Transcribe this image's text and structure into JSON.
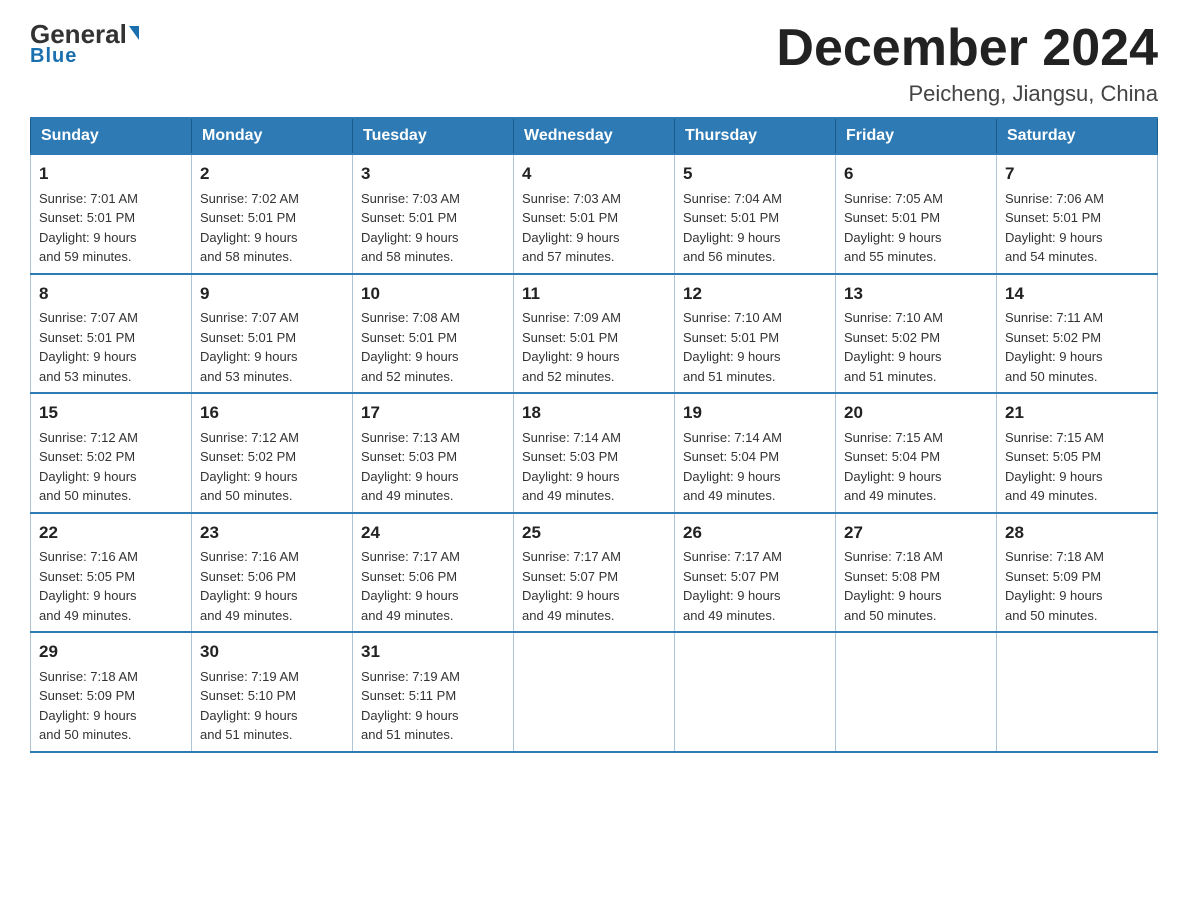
{
  "logo": {
    "line1_general": "General",
    "line1_blue": "Blue",
    "line2": "Blue"
  },
  "header": {
    "month_title": "December 2024",
    "subtitle": "Peicheng, Jiangsu, China"
  },
  "weekdays": [
    "Sunday",
    "Monday",
    "Tuesday",
    "Wednesday",
    "Thursday",
    "Friday",
    "Saturday"
  ],
  "weeks": [
    [
      {
        "day": "1",
        "sunrise": "7:01 AM",
        "sunset": "5:01 PM",
        "daylight": "9 hours and 59 minutes."
      },
      {
        "day": "2",
        "sunrise": "7:02 AM",
        "sunset": "5:01 PM",
        "daylight": "9 hours and 58 minutes."
      },
      {
        "day": "3",
        "sunrise": "7:03 AM",
        "sunset": "5:01 PM",
        "daylight": "9 hours and 58 minutes."
      },
      {
        "day": "4",
        "sunrise": "7:03 AM",
        "sunset": "5:01 PM",
        "daylight": "9 hours and 57 minutes."
      },
      {
        "day": "5",
        "sunrise": "7:04 AM",
        "sunset": "5:01 PM",
        "daylight": "9 hours and 56 minutes."
      },
      {
        "day": "6",
        "sunrise": "7:05 AM",
        "sunset": "5:01 PM",
        "daylight": "9 hours and 55 minutes."
      },
      {
        "day": "7",
        "sunrise": "7:06 AM",
        "sunset": "5:01 PM",
        "daylight": "9 hours and 54 minutes."
      }
    ],
    [
      {
        "day": "8",
        "sunrise": "7:07 AM",
        "sunset": "5:01 PM",
        "daylight": "9 hours and 53 minutes."
      },
      {
        "day": "9",
        "sunrise": "7:07 AM",
        "sunset": "5:01 PM",
        "daylight": "9 hours and 53 minutes."
      },
      {
        "day": "10",
        "sunrise": "7:08 AM",
        "sunset": "5:01 PM",
        "daylight": "9 hours and 52 minutes."
      },
      {
        "day": "11",
        "sunrise": "7:09 AM",
        "sunset": "5:01 PM",
        "daylight": "9 hours and 52 minutes."
      },
      {
        "day": "12",
        "sunrise": "7:10 AM",
        "sunset": "5:01 PM",
        "daylight": "9 hours and 51 minutes."
      },
      {
        "day": "13",
        "sunrise": "7:10 AM",
        "sunset": "5:02 PM",
        "daylight": "9 hours and 51 minutes."
      },
      {
        "day": "14",
        "sunrise": "7:11 AM",
        "sunset": "5:02 PM",
        "daylight": "9 hours and 50 minutes."
      }
    ],
    [
      {
        "day": "15",
        "sunrise": "7:12 AM",
        "sunset": "5:02 PM",
        "daylight": "9 hours and 50 minutes."
      },
      {
        "day": "16",
        "sunrise": "7:12 AM",
        "sunset": "5:02 PM",
        "daylight": "9 hours and 50 minutes."
      },
      {
        "day": "17",
        "sunrise": "7:13 AM",
        "sunset": "5:03 PM",
        "daylight": "9 hours and 49 minutes."
      },
      {
        "day": "18",
        "sunrise": "7:14 AM",
        "sunset": "5:03 PM",
        "daylight": "9 hours and 49 minutes."
      },
      {
        "day": "19",
        "sunrise": "7:14 AM",
        "sunset": "5:04 PM",
        "daylight": "9 hours and 49 minutes."
      },
      {
        "day": "20",
        "sunrise": "7:15 AM",
        "sunset": "5:04 PM",
        "daylight": "9 hours and 49 minutes."
      },
      {
        "day": "21",
        "sunrise": "7:15 AM",
        "sunset": "5:05 PM",
        "daylight": "9 hours and 49 minutes."
      }
    ],
    [
      {
        "day": "22",
        "sunrise": "7:16 AM",
        "sunset": "5:05 PM",
        "daylight": "9 hours and 49 minutes."
      },
      {
        "day": "23",
        "sunrise": "7:16 AM",
        "sunset": "5:06 PM",
        "daylight": "9 hours and 49 minutes."
      },
      {
        "day": "24",
        "sunrise": "7:17 AM",
        "sunset": "5:06 PM",
        "daylight": "9 hours and 49 minutes."
      },
      {
        "day": "25",
        "sunrise": "7:17 AM",
        "sunset": "5:07 PM",
        "daylight": "9 hours and 49 minutes."
      },
      {
        "day": "26",
        "sunrise": "7:17 AM",
        "sunset": "5:07 PM",
        "daylight": "9 hours and 49 minutes."
      },
      {
        "day": "27",
        "sunrise": "7:18 AM",
        "sunset": "5:08 PM",
        "daylight": "9 hours and 50 minutes."
      },
      {
        "day": "28",
        "sunrise": "7:18 AM",
        "sunset": "5:09 PM",
        "daylight": "9 hours and 50 minutes."
      }
    ],
    [
      {
        "day": "29",
        "sunrise": "7:18 AM",
        "sunset": "5:09 PM",
        "daylight": "9 hours and 50 minutes."
      },
      {
        "day": "30",
        "sunrise": "7:19 AM",
        "sunset": "5:10 PM",
        "daylight": "9 hours and 51 minutes."
      },
      {
        "day": "31",
        "sunrise": "7:19 AM",
        "sunset": "5:11 PM",
        "daylight": "9 hours and 51 minutes."
      },
      null,
      null,
      null,
      null
    ]
  ]
}
